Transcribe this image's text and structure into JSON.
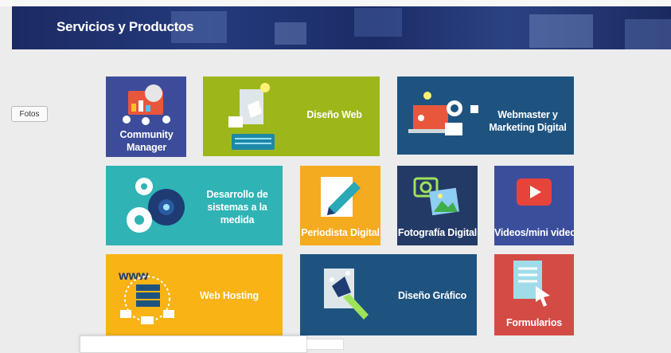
{
  "header": {
    "title": "Servicios y Productos"
  },
  "sidebar": {
    "fotos_label": "Fotos"
  },
  "tiles": {
    "community": "Community Manager",
    "diseno_web": "Diseño Web",
    "webmaster": "Webmaster y Marketing Digital",
    "desarrollo": "Desarrollo de sistemas a la medida",
    "periodista": "Periodista Digital",
    "fotografia": "Fotografía Digital",
    "videos": "Videos/mini videos",
    "hosting": "Web Hosting",
    "diseno_grafico": "Diseño Gráfico",
    "formularios": "Formularios"
  },
  "colors": {
    "header": "#1f2f6c",
    "community": "#3d4c9a",
    "diseno_web": "#9db71b",
    "webmaster": "#1e5380",
    "desarrollo": "#2fb3b5",
    "periodista": "#f5ab1f",
    "fotografia": "#243a66",
    "videos": "#3b4e9c",
    "hosting": "#f9b315",
    "diseno_grafico": "#1e5380",
    "formularios": "#d44b45"
  },
  "icons": [
    "people-chat-icon",
    "web-design-icon",
    "marketing-laptop-icon",
    "gears-icon",
    "pencil-document-icon",
    "camera-photo-icon",
    "play-video-icon",
    "www-server-icon",
    "pen-tool-icon",
    "form-cursor-icon"
  ]
}
